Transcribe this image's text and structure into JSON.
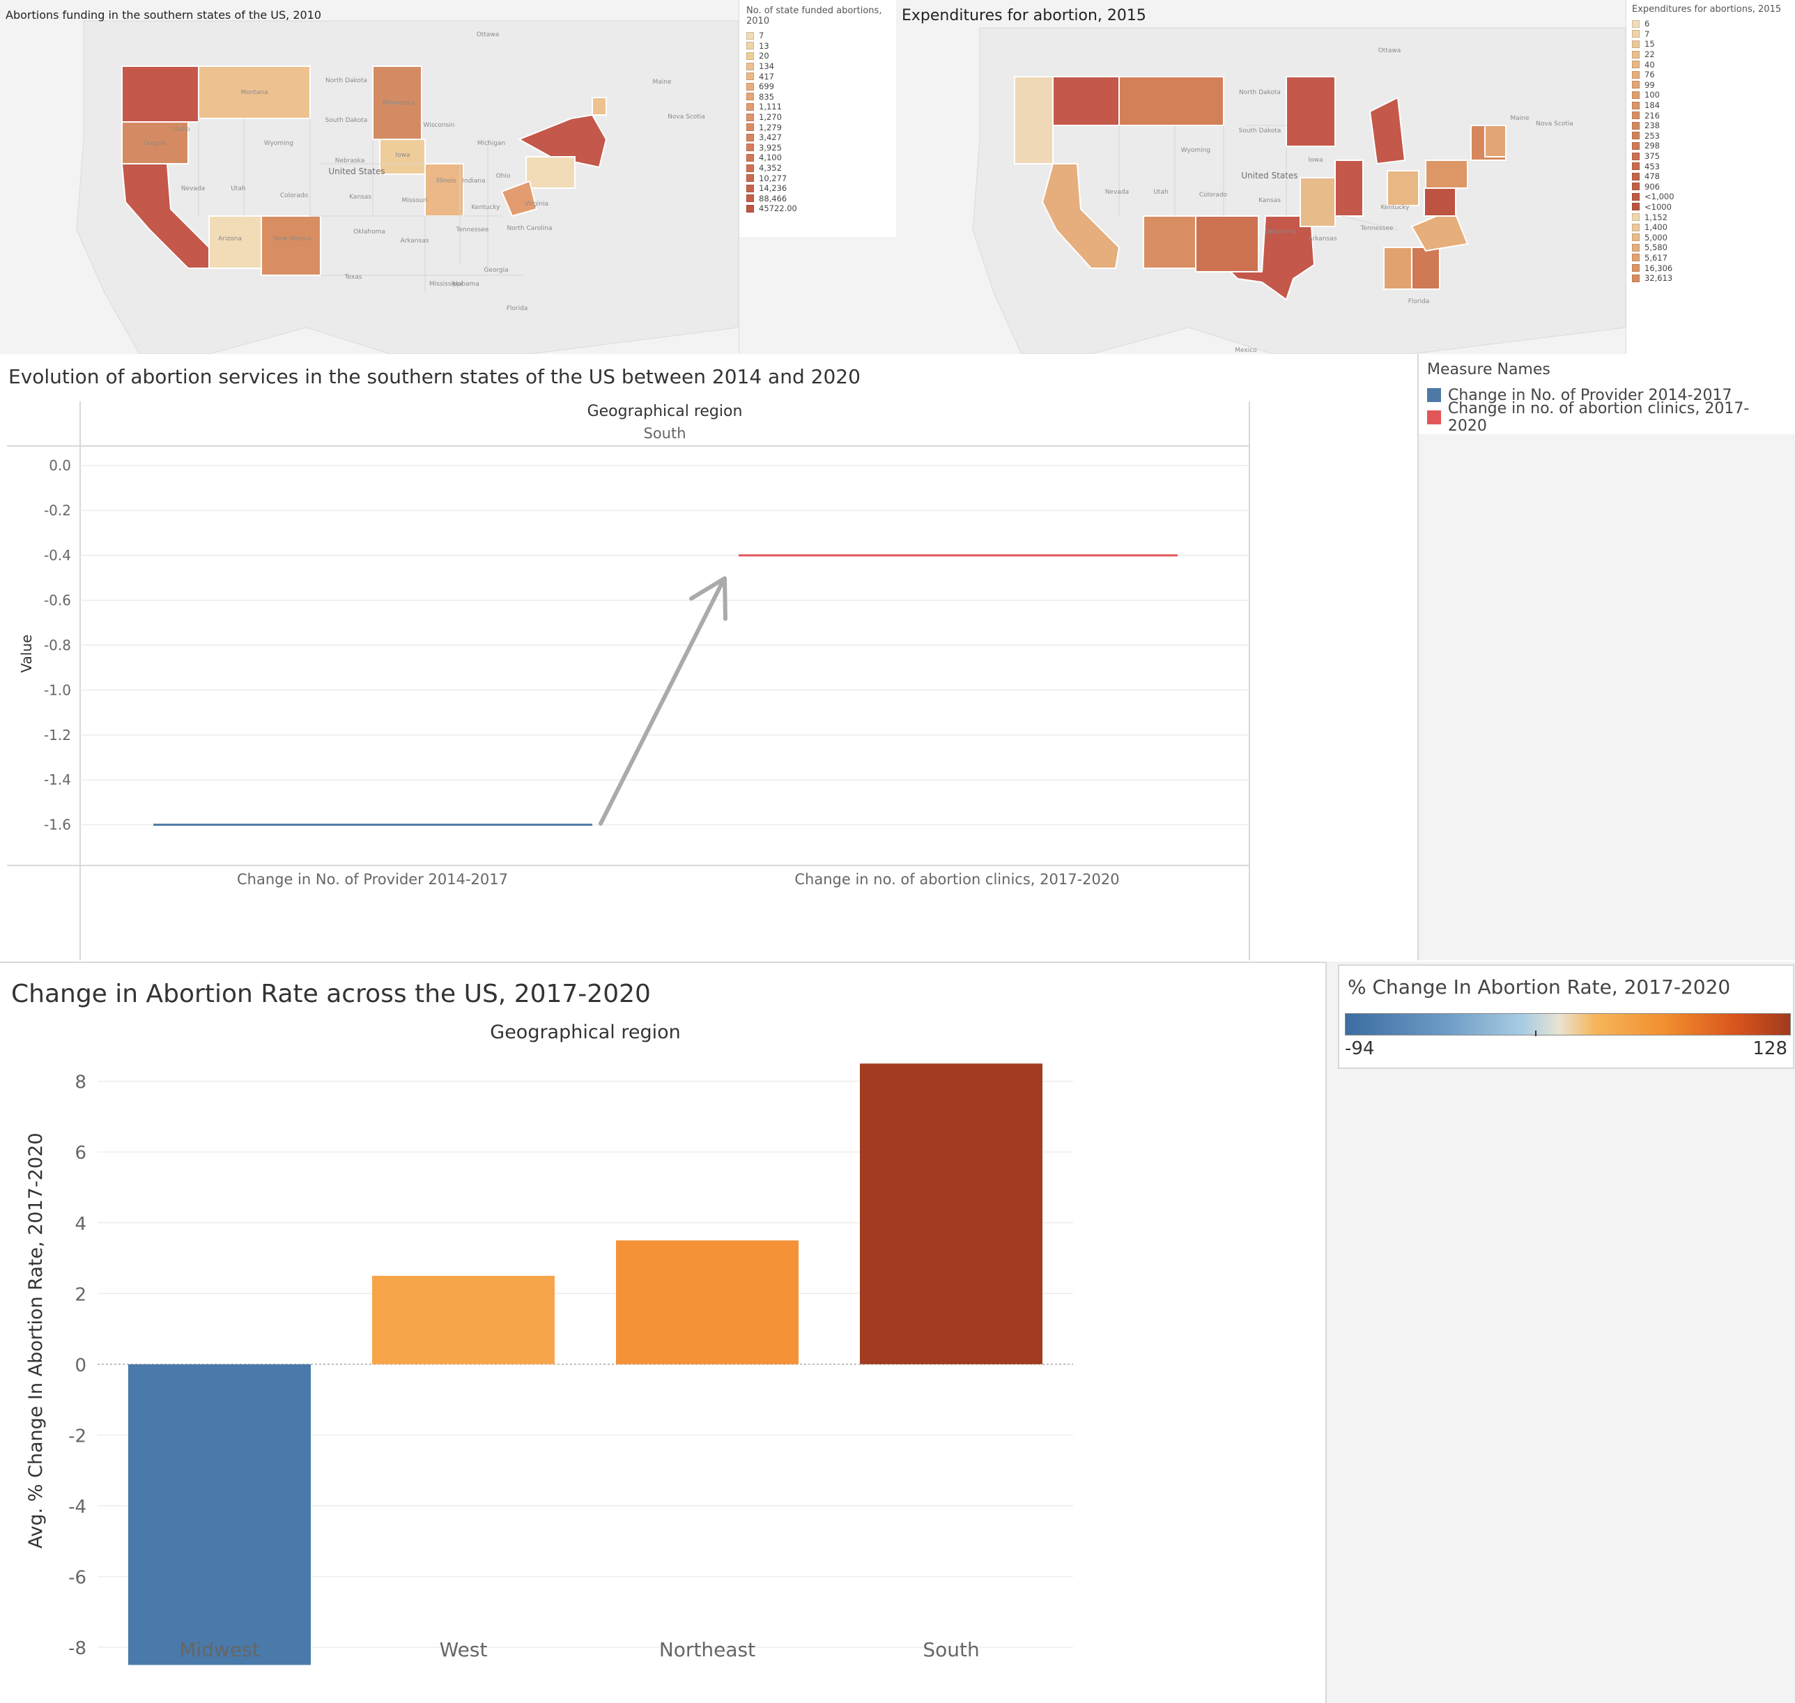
{
  "map_left": {
    "title": "Abortions funding in the southern states of the US, 2010",
    "legend_title": "No. of state funded abortions, 2010",
    "legend_items": [
      "7",
      "13",
      "20",
      "134",
      "417",
      "699",
      "835",
      "1,111",
      "1,270",
      "1,279",
      "3,427",
      "3,925",
      "4,100",
      "4,352",
      "10,277",
      "14,236",
      "88,466",
      "45722.00"
    ],
    "legend_colors": [
      "#f1dcb7",
      "#efd4a8",
      "#efcd9b",
      "#eec190",
      "#ecb887",
      "#e9ad7d",
      "#e7a675",
      "#e29c6f",
      "#df9369",
      "#db8b64",
      "#d8845f",
      "#d57d5a",
      "#d27756",
      "#cf7153",
      "#cb6a4f",
      "#c8634b",
      "#c45e48",
      "#c05744"
    ],
    "place_labels": [
      "Ottawa",
      "North Dakota",
      "South Dakota",
      "Nebraska",
      "United States",
      "Kansas",
      "Oklahoma",
      "Texas",
      "Idaho",
      "Wyoming",
      "Colorado",
      "Nevada",
      "Utah",
      "Arizona",
      "New Mexico",
      "Montana",
      "Oregon",
      "Minnesota",
      "Wisconsin",
      "Michigan",
      "Iowa",
      "Missouri",
      "Illinois",
      "Indiana",
      "Ohio",
      "Arkansas",
      "Tennessee",
      "Mississippi",
      "Alabama",
      "Georgia",
      "North Carolina",
      "Kentucky",
      "Virginia",
      "Florida",
      "Maine",
      "Nova Scotia"
    ]
  },
  "map_right": {
    "title": "Expenditures for abortion, 2015",
    "legend_title": "Expenditures for abortions, 2015",
    "legend_items": [
      "6",
      "7",
      "15",
      "22",
      "40",
      "76",
      "99",
      "100",
      "184",
      "216",
      "238",
      "253",
      "298",
      "375",
      "453",
      "478",
      "906",
      "<1,000",
      "<1000",
      "1,152",
      "1,400",
      "5,000",
      "5,580",
      "5,617",
      "16,306",
      "32,613"
    ],
    "legend_colors": [
      "#f1dcb7",
      "#efd3a6",
      "#edc998",
      "#ebc08c",
      "#e9b783",
      "#e6ae7b",
      "#e3a574",
      "#e09d6d",
      "#dc9567",
      "#d98e62",
      "#d6875d",
      "#d38059",
      "#cf7955",
      "#cc7251",
      "#c96c4e",
      "#c5664a",
      "#c26047",
      "#bf5a44",
      "#bc5441",
      "#efd8ae",
      "#ecc89b",
      "#e8bb8a",
      "#e5ae7c",
      "#e1a270",
      "#dd9766",
      "#d98d5f"
    ],
    "place_labels": [
      "Ottawa",
      "North Dakota",
      "South Dakota",
      "Wyoming",
      "United States",
      "Kansas",
      "Oklahoma",
      "Nevada",
      "Utah",
      "Colorado",
      "Iowa",
      "Arkansas",
      "Tennessee",
      "Kentucky",
      "Florida",
      "Maine",
      "Nova Scotia",
      "Mexico"
    ]
  },
  "line_chart": {
    "title": "Evolution of abortion services in the southern states of the US between 2014 and 2020",
    "header": "Geographical region",
    "region": "South",
    "y_axis_label": "Value",
    "legend_title": "Measure Names",
    "chart_data": {
      "type": "line",
      "categories": [
        "Change in No. of Provider 2014-2017",
        "Change in no. of abortion clinics, 2017-2020"
      ],
      "series": [
        {
          "name": "Change in No. of Provider 2014-2017",
          "values": [
            -1.6,
            null
          ],
          "color": "#4e79a7"
        },
        {
          "name": "Change in no. of abortion clinics, 2017-2020",
          "values": [
            null,
            -0.4
          ],
          "color": "#e15759"
        }
      ],
      "y_ticks": [
        "0.0",
        "-0.2",
        "-0.4",
        "-0.6",
        "-0.8",
        "-1.0",
        "-1.2",
        "-1.4",
        "-1.6"
      ],
      "ylim": [
        -1.75,
        0.05
      ]
    }
  },
  "bar_chart": {
    "title": "Change in Abortion Rate across the US, 2017-2020",
    "header": "Geographical region",
    "y_axis_label": "Avg. % Change In Abortion Rate, 2017-2020",
    "legend_title": "% Change In Abortion Rate, 2017-2020",
    "legend_min": "-94",
    "legend_max": "128",
    "chart_data": {
      "type": "bar",
      "categories": [
        "Midwest",
        "West",
        "Northeast",
        "South"
      ],
      "values": [
        -8.5,
        2.5,
        3.5,
        8.5
      ],
      "colors": [
        "#4a7aaa",
        "#f7a54a",
        "#f59238",
        "#a13c22"
      ],
      "y_ticks": [
        "8",
        "6",
        "4",
        "2",
        "0",
        "-2",
        "-4",
        "-6",
        "-8"
      ],
      "ylim": [
        -9.3,
        8.9
      ]
    }
  }
}
